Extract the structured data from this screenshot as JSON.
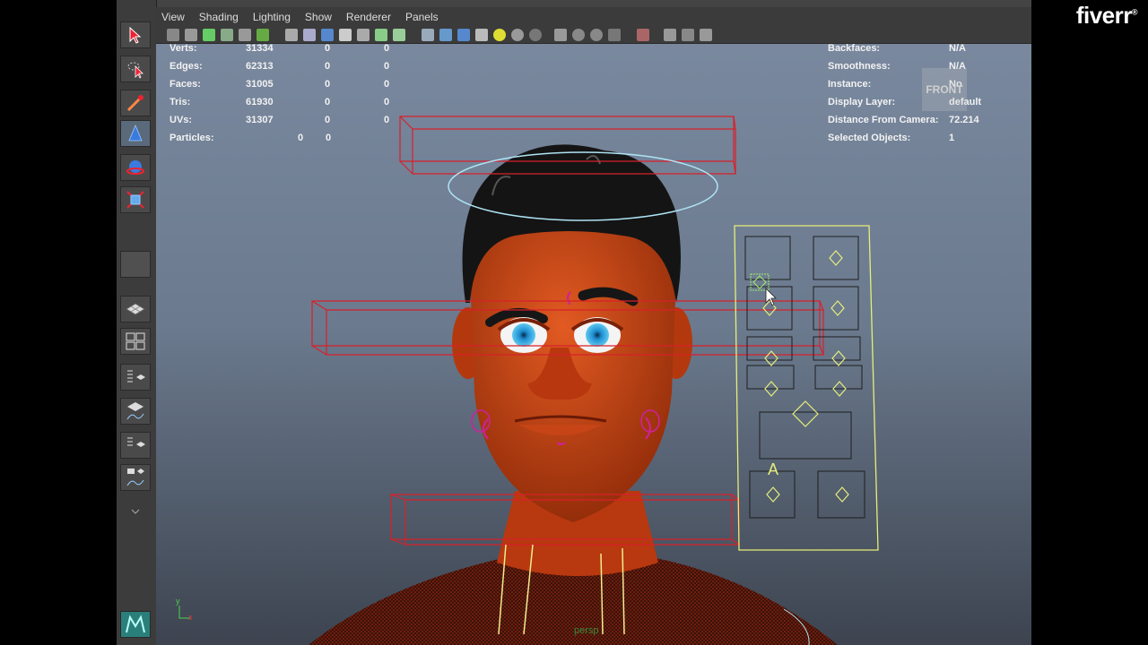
{
  "watermark": "fiverr",
  "menus": [
    "View",
    "Shading",
    "Lighting",
    "Show",
    "Renderer",
    "Panels"
  ],
  "hud_left": [
    {
      "label": "Verts:",
      "a": "31334",
      "b": "0",
      "c": "0"
    },
    {
      "label": "Edges:",
      "a": "62313",
      "b": "0",
      "c": "0"
    },
    {
      "label": "Faces:",
      "a": "31005",
      "b": "0",
      "c": "0"
    },
    {
      "label": "Tris:",
      "a": "61930",
      "b": "0",
      "c": "0"
    },
    {
      "label": "UVs:",
      "a": "31307",
      "b": "0",
      "c": "0"
    },
    {
      "label": "Particles:",
      "a": "",
      "b": "0",
      "c": "0"
    }
  ],
  "hud_right": [
    {
      "label": "Backfaces:",
      "value": "N/A"
    },
    {
      "label": "Smoothness:",
      "value": "N/A"
    },
    {
      "label": "Instance:",
      "value": "No"
    },
    {
      "label": "Display Layer:",
      "value": "default"
    },
    {
      "label": "Distance From Camera:",
      "value": "72.214"
    },
    {
      "label": "Selected Objects:",
      "value": "1"
    }
  ],
  "view_label": "FRONT",
  "camera_label": "persp",
  "control_letter": "A",
  "axis": {
    "y": "y",
    "x": "x"
  },
  "colors": {
    "skin": "#c8441a",
    "rig_red": "#d8202a",
    "controller_yellow": "#e6ee7a",
    "halo_blue": "#aee4f4",
    "magenta": "#d020a0"
  }
}
